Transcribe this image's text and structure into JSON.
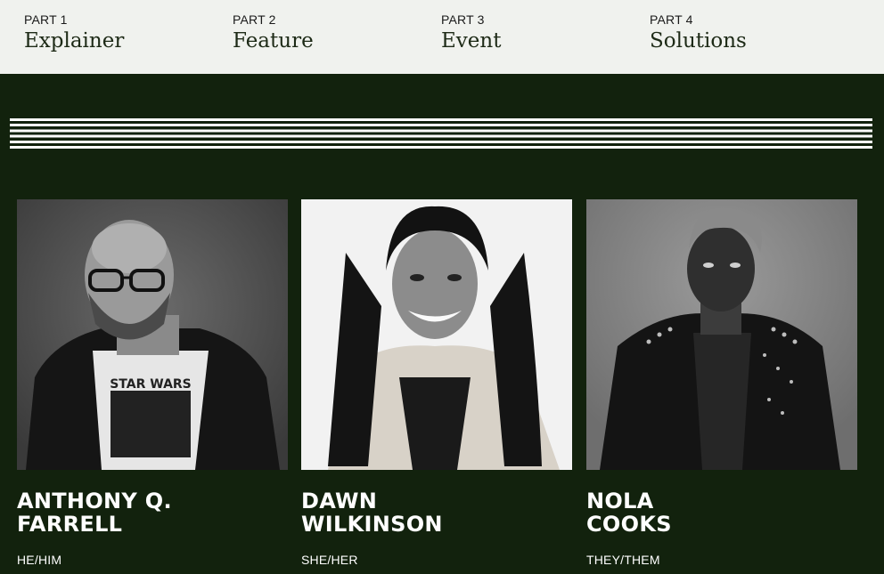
{
  "nav": [
    {
      "part": "PART 1",
      "title": "Explainer"
    },
    {
      "part": "PART 2",
      "title": "Feature"
    },
    {
      "part": "PART 3",
      "title": "Event"
    },
    {
      "part": "PART 4",
      "title": "Solutions"
    }
  ],
  "speakers": [
    {
      "name_line1": "ANTHONY Q.",
      "name_line2": "FARRELL",
      "pronouns": "HE/HIM",
      "shirt_text": "STAR WARS"
    },
    {
      "name_line1": "DAWN",
      "name_line2": "WILKINSON",
      "pronouns": "SHE/HER"
    },
    {
      "name_line1": "NOLA",
      "name_line2": "COOKS",
      "pronouns": "THEY/THEM"
    }
  ],
  "colors": {
    "background": "#12220d",
    "nav_background": "#f0f2ee",
    "text": "#ffffff"
  }
}
